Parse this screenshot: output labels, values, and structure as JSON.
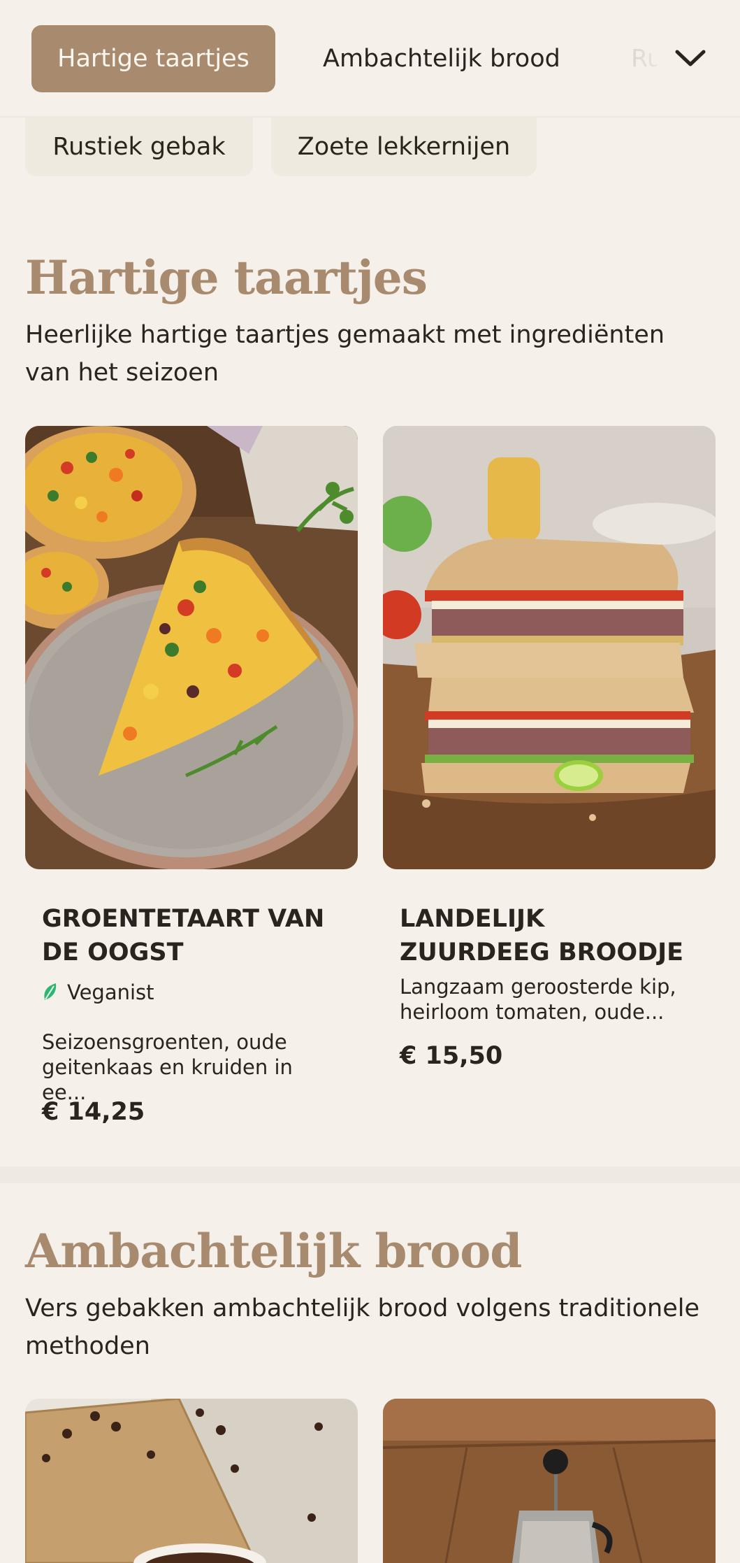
{
  "nav": {
    "tabs": [
      {
        "label": "Hartige taartjes"
      },
      {
        "label": "Ambachtelijk brood"
      },
      {
        "label": "Ru"
      },
      {
        "label": "Rustiek gebak"
      },
      {
        "label": "Zoete lekkernijen"
      }
    ],
    "expand_icon": "chevron-down-icon"
  },
  "sections": [
    {
      "title": "Hartige taartjes",
      "description": "Heerlijke hartige taartjes gemaakt met ingrediënten van het seizoen",
      "products": [
        {
          "name": "GROENTETAART VAN DE OOGST",
          "badge": "Veganist",
          "badge_icon": "leaf-icon",
          "description": "Seizoensgroenten, oude geitenkaas en kruiden in ee...",
          "price": "€ 14,25"
        },
        {
          "name": "LANDELIJK ZUURDEEG BROODJE",
          "description": "Langzaam geroosterde kip, heirloom tomaten, oude...",
          "price": "€ 15,50"
        }
      ]
    },
    {
      "title": "Ambachtelijk brood",
      "description": "Vers gebakken ambachtelijk brood volgens traditionele methoden"
    }
  ],
  "colors": {
    "accent": "#a88a6f",
    "background": "#f5f1ea",
    "text": "#2a241f",
    "vegan_green": "#2bb673"
  }
}
